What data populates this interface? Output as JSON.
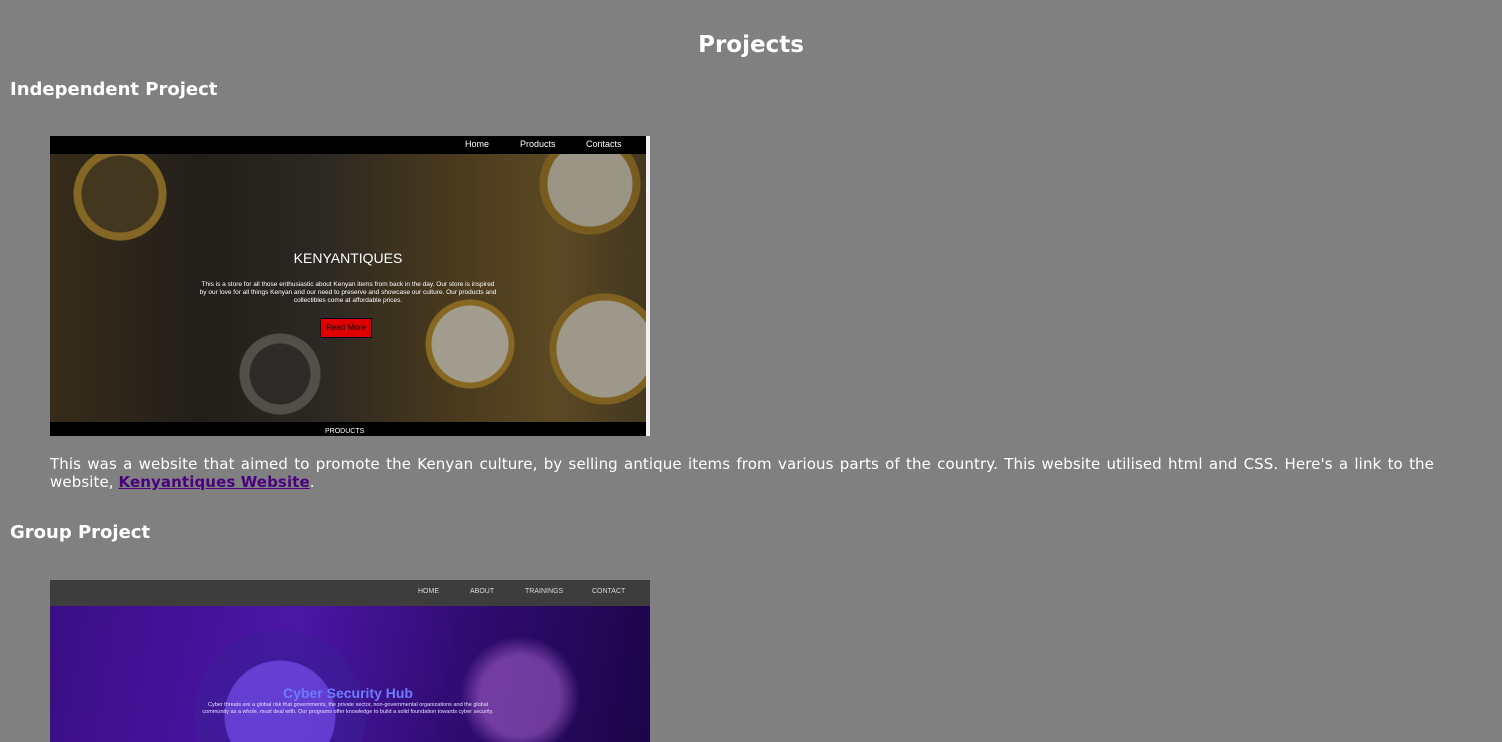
{
  "page": {
    "title": "Projects"
  },
  "sections": {
    "independent": {
      "heading": "Independent Project",
      "screenshot": {
        "nav": [
          "Home",
          "Products",
          "Contacts"
        ],
        "title": "KENYANTIQUES",
        "description": "This is a store for all those enthusiastic about Kenyan items from back in the day. Our store is inspired by our love for all things Kenyan and our need to preserve and showcase our culture. Our products and collectibles come at affordable prices.",
        "button": "Read More",
        "strip_label": "PRODUCTS"
      },
      "description_prefix": "This was a website that aimed to promote the Kenyan culture, by selling antique items from various parts of the country. This website utilised html and CSS. Here's a link to the website, ",
      "link_text": "Kenyantiques Website",
      "description_suffix": "."
    },
    "group": {
      "heading": "Group Project",
      "screenshot": {
        "nav": [
          "HOME",
          "ABOUT",
          "TRAININGS",
          "CONTACT"
        ],
        "title": "Cyber Security Hub",
        "description": "Cyber threats are a global risk that governments, the private sector, non-governmental organizations and the global community as a whole, must deal with. Our programs offer knowledge to build a solid foundation towards cyber security."
      }
    }
  },
  "colors": {
    "background": "#808080",
    "text": "#ffffff",
    "link": "#4b0082",
    "read_more_button": "#e00000",
    "cyber_title": "#6d7cff"
  }
}
